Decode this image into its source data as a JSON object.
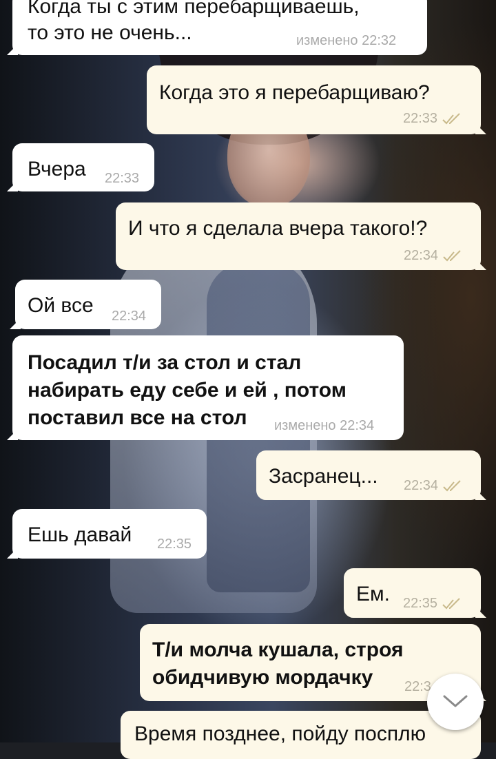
{
  "messages": [
    {
      "id": "m1",
      "dir": "in",
      "lines": [
        "Когда ты с этим перебарщиваешь,",
        "то это не очень..."
      ],
      "meta": "изменено 22:32"
    },
    {
      "id": "m2",
      "dir": "out",
      "lines": [
        "Когда это я перебарщиваю?"
      ],
      "meta": "22:33"
    },
    {
      "id": "m3",
      "dir": "in",
      "lines": [
        "Вчера"
      ],
      "meta": "22:33"
    },
    {
      "id": "m4",
      "dir": "out",
      "lines": [
        "И что я сделала вчера такого!?"
      ],
      "meta": "22:34"
    },
    {
      "id": "m5",
      "dir": "in",
      "lines": [
        "Ой все"
      ],
      "meta": "22:34"
    },
    {
      "id": "m6",
      "dir": "in",
      "lines": [
        "Посадил т/и за стол и стал",
        "набирать еду себе и ей , потом",
        "поставил все на стол"
      ],
      "meta": "изменено 22:34"
    },
    {
      "id": "m7",
      "dir": "out",
      "lines": [
        "Засранец..."
      ],
      "meta": "22:34"
    },
    {
      "id": "m8",
      "dir": "in",
      "lines": [
        "Ешь давай"
      ],
      "meta": "22:35"
    },
    {
      "id": "m9",
      "dir": "out",
      "lines": [
        "Ем."
      ],
      "meta": "22:35"
    },
    {
      "id": "m10",
      "dir": "out",
      "lines": [
        "Т/и молча кушала, строя",
        "обидчивую мордачку"
      ],
      "meta": "22:3"
    },
    {
      "id": "m11",
      "dir": "out",
      "lines": [
        "Время позднее, пойду посплю"
      ],
      "meta": ""
    }
  ],
  "icons": {
    "read": "double-check-icon",
    "scroll": "chevron-down-icon"
  },
  "colors": {
    "incoming": "#ffffff",
    "outgoing": "#fdf8e8",
    "check": "#c8b98a"
  }
}
